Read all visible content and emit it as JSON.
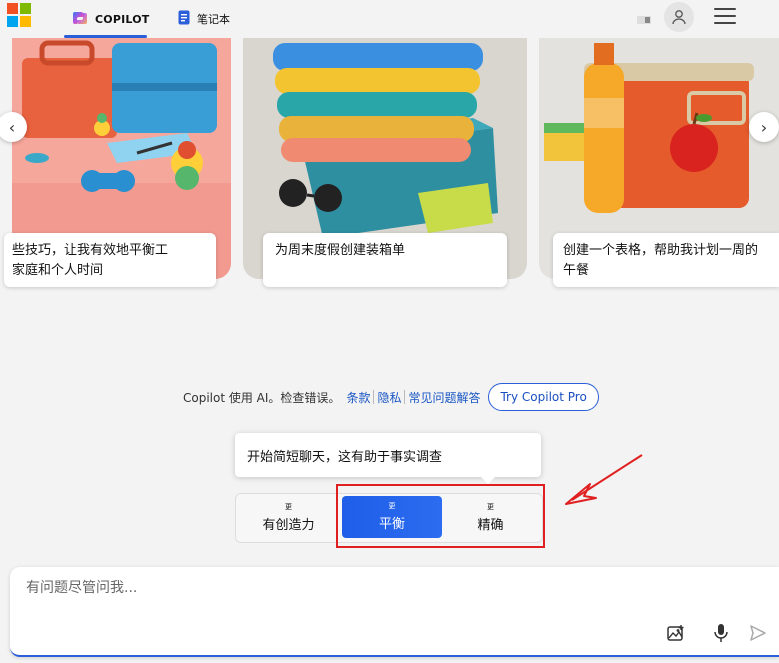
{
  "header": {
    "tabs": [
      {
        "label": "COPILOT",
        "icon": "copilot-icon",
        "active": true
      },
      {
        "label": "笔记本",
        "icon": "notebook-icon",
        "active": false
      }
    ],
    "icons": [
      "microsoft-logo",
      "account-icon",
      "menu-icon"
    ],
    "accent": "#2b5fd9"
  },
  "cards": [
    {
      "caption": "些技巧，让我有效地平衡工家庭和个人时间",
      "caption_line1": "些技巧，让我有效地平衡工",
      "caption_line2": "家庭和个人时间"
    },
    {
      "caption": "为周末度假创建装箱单"
    },
    {
      "caption": "创建一个表格，帮助我计划一周的午餐",
      "caption_line1": "创建一个表格，帮助我计划一周的",
      "caption_line2": "午餐"
    }
  ],
  "disclaimer": {
    "text": "Copilot 使用 AI。检查错误。",
    "links": [
      "条款",
      "隐私",
      "常见问题解答"
    ],
    "pro_button": "Try Copilot Pro"
  },
  "tooltip": "开始简短聊天，这有助于事实调查",
  "styles": [
    {
      "small": "更",
      "label": "有创造力",
      "active": false
    },
    {
      "small": "更",
      "label": "平衡",
      "active": true
    },
    {
      "small": "更",
      "label": "精确",
      "active": false
    }
  ],
  "input": {
    "placeholder": "有问题尽管问我..."
  },
  "colors": {
    "annotation": "#e02020"
  }
}
